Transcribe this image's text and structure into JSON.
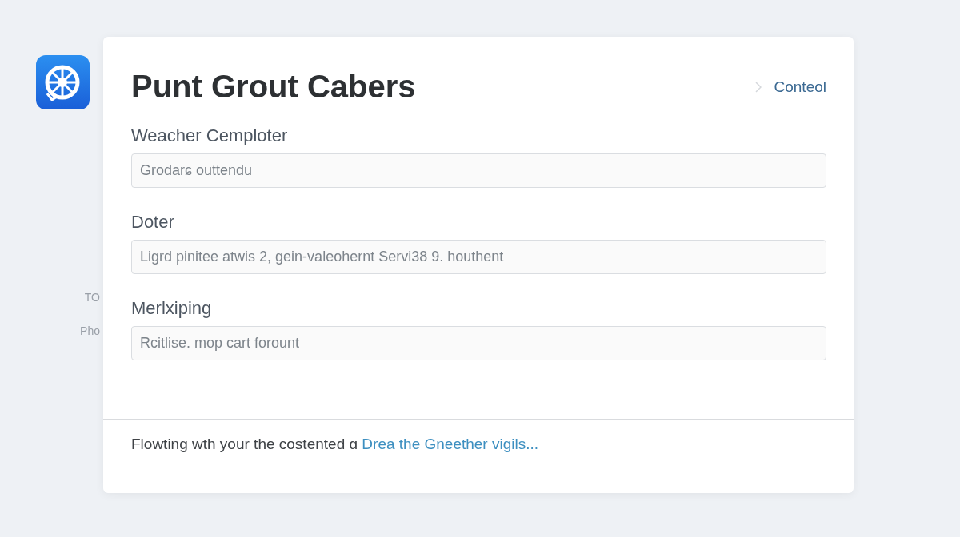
{
  "side": {
    "labels": [
      "TO",
      "Pho"
    ]
  },
  "card": {
    "title": "Punt Grout Cabers",
    "action": "Conteol",
    "fields": [
      {
        "label": "Weacher Cemploter",
        "placeholder": "Grodarɕ outtendu"
      },
      {
        "label": "Doter",
        "placeholder": "Ligrd pinitee atwis 2, gein-valeohernt Servi38 9. houthent"
      },
      {
        "label": "Merlxiping",
        "placeholder": "Rcitlise. mop cart forount"
      }
    ],
    "footer": {
      "text": "Flowting wth your the costented ɑ",
      "link": "Drea the Gneether vigils..."
    }
  }
}
